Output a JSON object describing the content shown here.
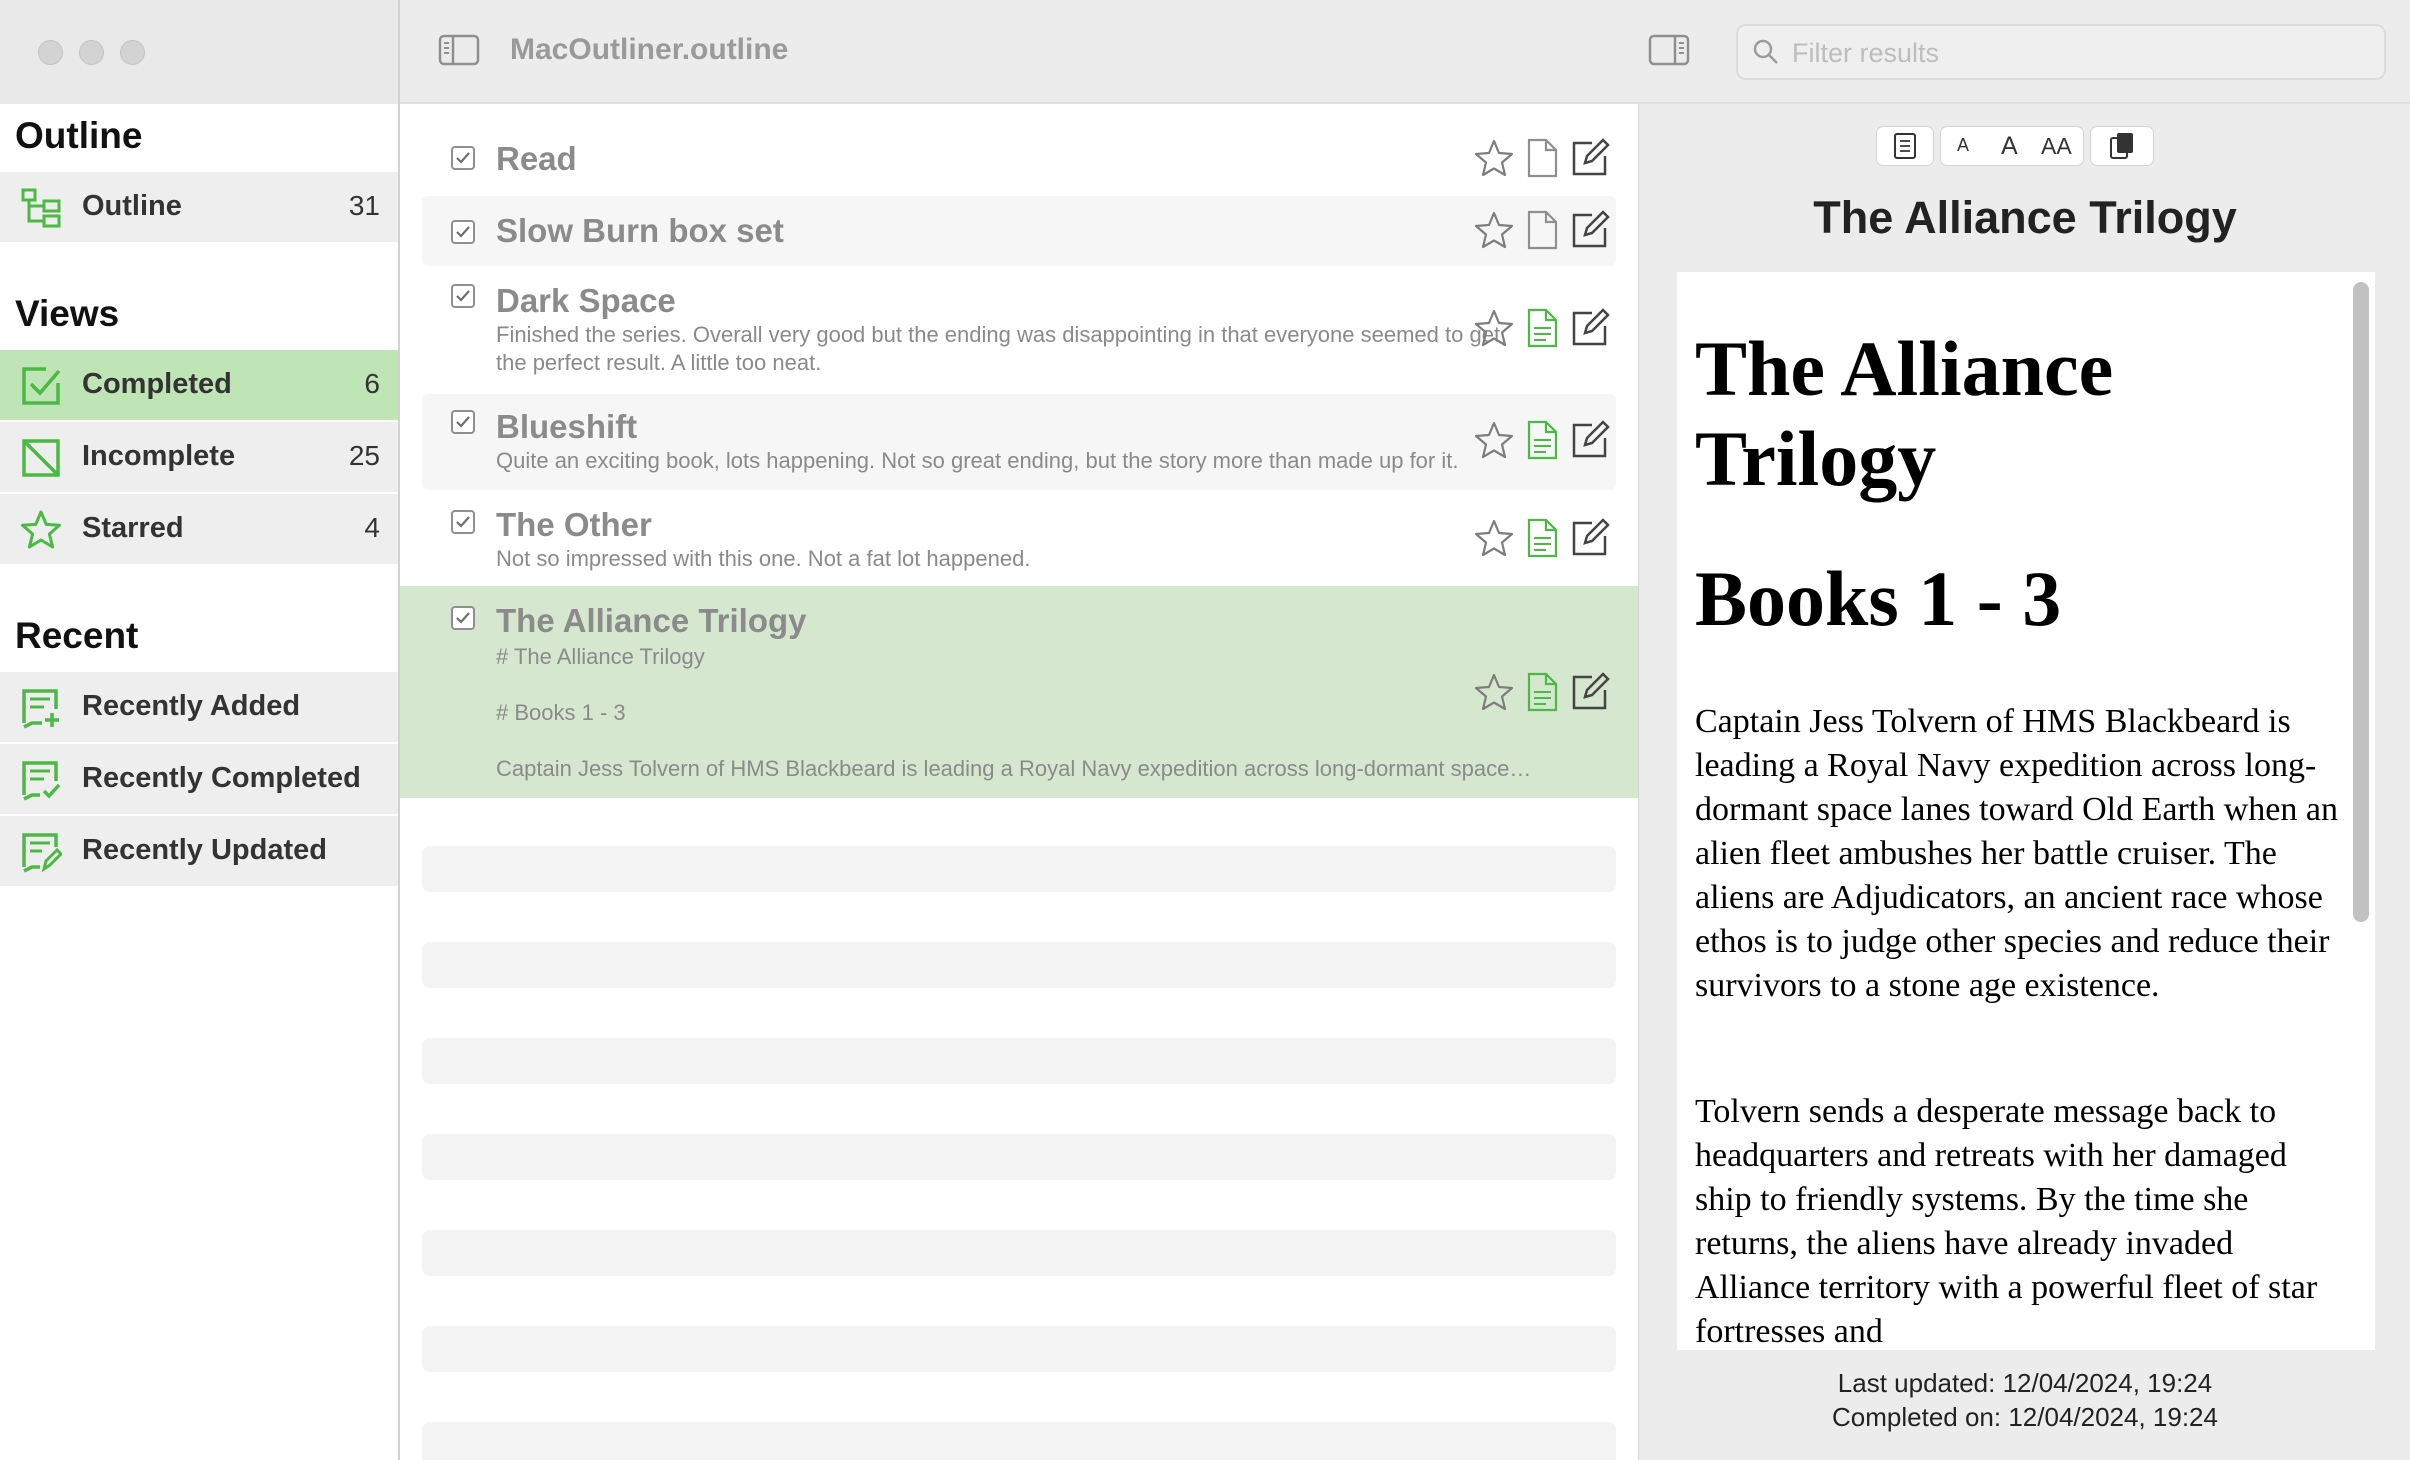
{
  "toolbar": {
    "doc_title": "MacOutliner.outline",
    "search_placeholder": "Filter results"
  },
  "sidebar": {
    "sections": {
      "outline": "Outline",
      "views": "Views",
      "recent": "Recent"
    },
    "items": [
      {
        "label": "Outline",
        "count": "31",
        "icon": "outline-tree-icon"
      },
      {
        "label": "Completed",
        "count": "6",
        "icon": "checkbox-checked-icon",
        "selected": true
      },
      {
        "label": "Incomplete",
        "count": "25",
        "icon": "checkbox-slashed-icon"
      },
      {
        "label": "Starred",
        "count": "4",
        "icon": "star-icon"
      },
      {
        "label": "Recently Added",
        "count": "",
        "icon": "note-plus-icon"
      },
      {
        "label": "Recently Completed",
        "count": "",
        "icon": "note-check-icon"
      },
      {
        "label": "Recently Updated",
        "count": "",
        "icon": "note-edit-icon"
      }
    ]
  },
  "rows": [
    {
      "title": "Read",
      "notes": [],
      "checked": true
    },
    {
      "title": "Slow Burn box set",
      "notes": [],
      "checked": true
    },
    {
      "title": "Dark Space",
      "notes": [
        "Finished the series. Overall very good but the ending was disappointing in that everyone seemed to get",
        "the perfect result. A little too neat."
      ],
      "checked": true
    },
    {
      "title": "Blueshift",
      "notes": [
        "Quite an exciting book, lots happening. Not so great ending, but the story more than made up for it."
      ],
      "checked": true
    },
    {
      "title": "The Other",
      "notes": [
        "Not so impressed with this one. Not a fat lot happened."
      ],
      "checked": true
    },
    {
      "title": "The Alliance Trilogy",
      "notes": [
        "# The Alliance Trilogy",
        "# Books 1 - 3",
        "Captain Jess Tolvern of HMS Blackbeard is leading a Royal Navy expedition across long-dormant space…"
      ],
      "checked": true,
      "selected": true
    }
  ],
  "inspector": {
    "title": "The Alliance Trilogy",
    "font_buttons": [
      "A",
      "A",
      "AA"
    ],
    "preview": {
      "h1a": "The Alliance Trilogy",
      "h1b": "Books 1 - 3",
      "p1": "Captain Jess Tolvern of HMS Blackbeard is leading a Royal Navy expedition across long-dormant space lanes toward Old Earth when an alien fleet ambushes her battle cruiser. The aliens are Adjudicators, an ancient race whose ethos is to judge other species and reduce their survivors to a stone age existence.",
      "p2": "Tolvern sends a desperate message back to headquarters and retreats with her damaged ship to friendly systems. By the time she returns, the aliens have already invaded Alliance territory with a powerful fleet of star fortresses and"
    },
    "last_updated": "Last updated: 12/04/2024, 19:24",
    "completed_on": "Completed on: 12/04/2024, 19:24"
  },
  "colors": {
    "accent": "#4cb944",
    "selection": "#bfe4b6",
    "row_selection": "#d5e8cf"
  }
}
